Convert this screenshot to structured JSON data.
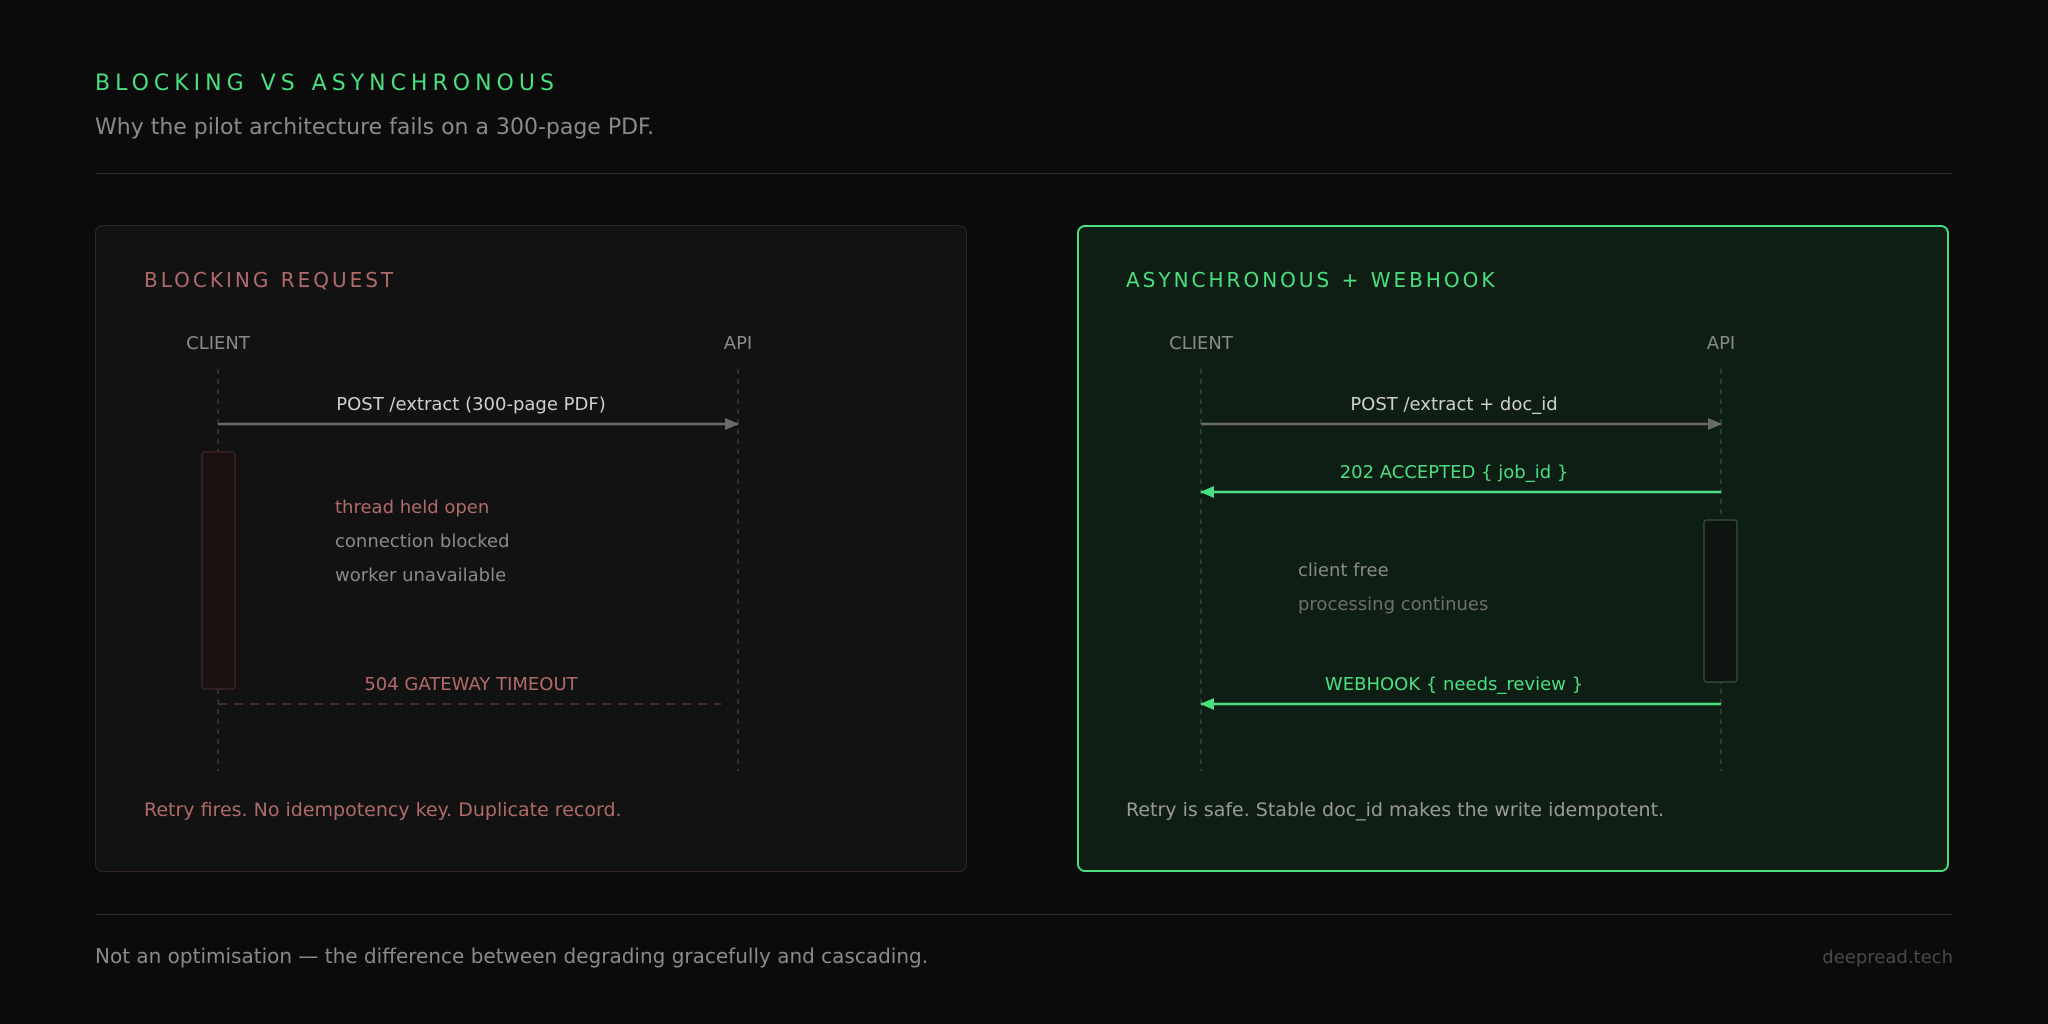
{
  "header": {
    "title": "BLOCKING VS ASYNCHRONOUS",
    "subtitle": "Why the pilot architecture fails on a 300-page PDF."
  },
  "colors": {
    "accent_green": "#4ade80",
    "accent_red": "#b06a6a",
    "muted_text": "#8a8a8a",
    "background": "#0b0b0b"
  },
  "blocking": {
    "title": "BLOCKING REQUEST",
    "client_label": "CLIENT",
    "api_label": "API",
    "request_label": "POST /extract (300-page PDF)",
    "note_primary": "thread held open",
    "note_secondary_1": "connection blocked",
    "note_secondary_2": "worker unavailable",
    "timeout_label": "504 GATEWAY TIMEOUT",
    "caption": "Retry fires. No idempotency key. Duplicate record."
  },
  "async": {
    "title": "ASYNCHRONOUS + WEBHOOK",
    "client_label": "CLIENT",
    "api_label": "API",
    "request_label": "POST /extract + doc_id",
    "accepted_label": "202 ACCEPTED { job_id }",
    "note_primary": "client free",
    "note_secondary": "processing continues",
    "webhook_label": "WEBHOOK { needs_review }",
    "caption": "Retry is safe. Stable doc_id makes the write idempotent."
  },
  "footer": {
    "note": "Not an optimisation — the difference between degrading gracefully and cascading.",
    "brand": "deepread.tech"
  }
}
